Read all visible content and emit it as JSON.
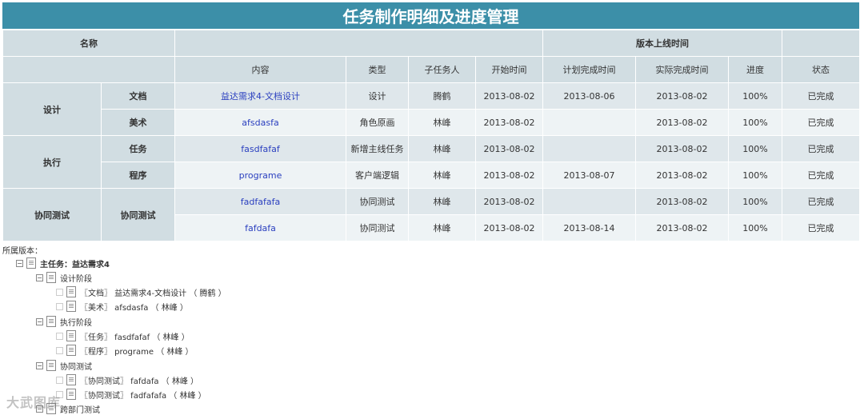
{
  "title": "任务制作明细及进度管理",
  "header": {
    "name": "名称",
    "version_time": "版本上线时间"
  },
  "columns": [
    "内容",
    "类型",
    "子任务人",
    "开始时间",
    "计划完成时间",
    "实际完成时间",
    "进度",
    "状态"
  ],
  "groups": [
    {
      "name": "设计"
    },
    {
      "name": "执行"
    },
    {
      "name": "协同测试"
    }
  ],
  "rows": [
    {
      "sub": "文档",
      "content": "益达需求4-文档设计",
      "type": "设计",
      "person": "腾鹤",
      "start": "2013-08-02",
      "plan": "2013-08-06",
      "actual": "2013-08-02",
      "progress": "100%",
      "status": "已完成"
    },
    {
      "sub": "美术",
      "content": "afsdasfa",
      "type": "角色原画",
      "person": "林峰",
      "start": "2013-08-02",
      "plan": "",
      "actual": "2013-08-02",
      "progress": "100%",
      "status": "已完成"
    },
    {
      "sub": "任务",
      "content": "fasdfafaf",
      "type": "新增主线任务",
      "person": "林峰",
      "start": "2013-08-02",
      "plan": "",
      "actual": "2013-08-02",
      "progress": "100%",
      "status": "已完成"
    },
    {
      "sub": "程序",
      "content": "programe",
      "type": "客户端逻辑",
      "person": "林峰",
      "start": "2013-08-02",
      "plan": "2013-08-07",
      "actual": "2013-08-02",
      "progress": "100%",
      "status": "已完成"
    },
    {
      "sub": "协同测试",
      "content": "fadfafafa",
      "type": "协同测试",
      "person": "林峰",
      "start": "2013-08-02",
      "plan": "",
      "actual": "2013-08-02",
      "progress": "100%",
      "status": "已完成"
    },
    {
      "sub": "",
      "content": "fafdafa",
      "type": "协同测试",
      "person": "林峰",
      "start": "2013-08-02",
      "plan": "2013-08-14",
      "actual": "2013-08-02",
      "progress": "100%",
      "status": "已完成"
    }
  ],
  "tree": {
    "label": "所属版本：",
    "root": "主任务：益达需求4",
    "phase1": "设计阶段",
    "p1_item1": "〖文档〗 益达需求4-文档设计 （ 腾鹤 ）",
    "p1_item2": "〖美术〗 afsdasfa （ 林峰 ）",
    "phase2": "执行阶段",
    "p2_item1": "〖任务〗 fasdfafaf （ 林峰 ）",
    "p2_item2": "〖程序〗 programe （ 林峰 ）",
    "phase3": "协同测试",
    "p3_item1": "〖协同测试〗 fafdafa （ 林峰 ）",
    "p3_item2": "〖协同测试〗 fadfafafa （ 林峰 ）",
    "phase4": "跨部门测试"
  },
  "watermark": "大武图库"
}
